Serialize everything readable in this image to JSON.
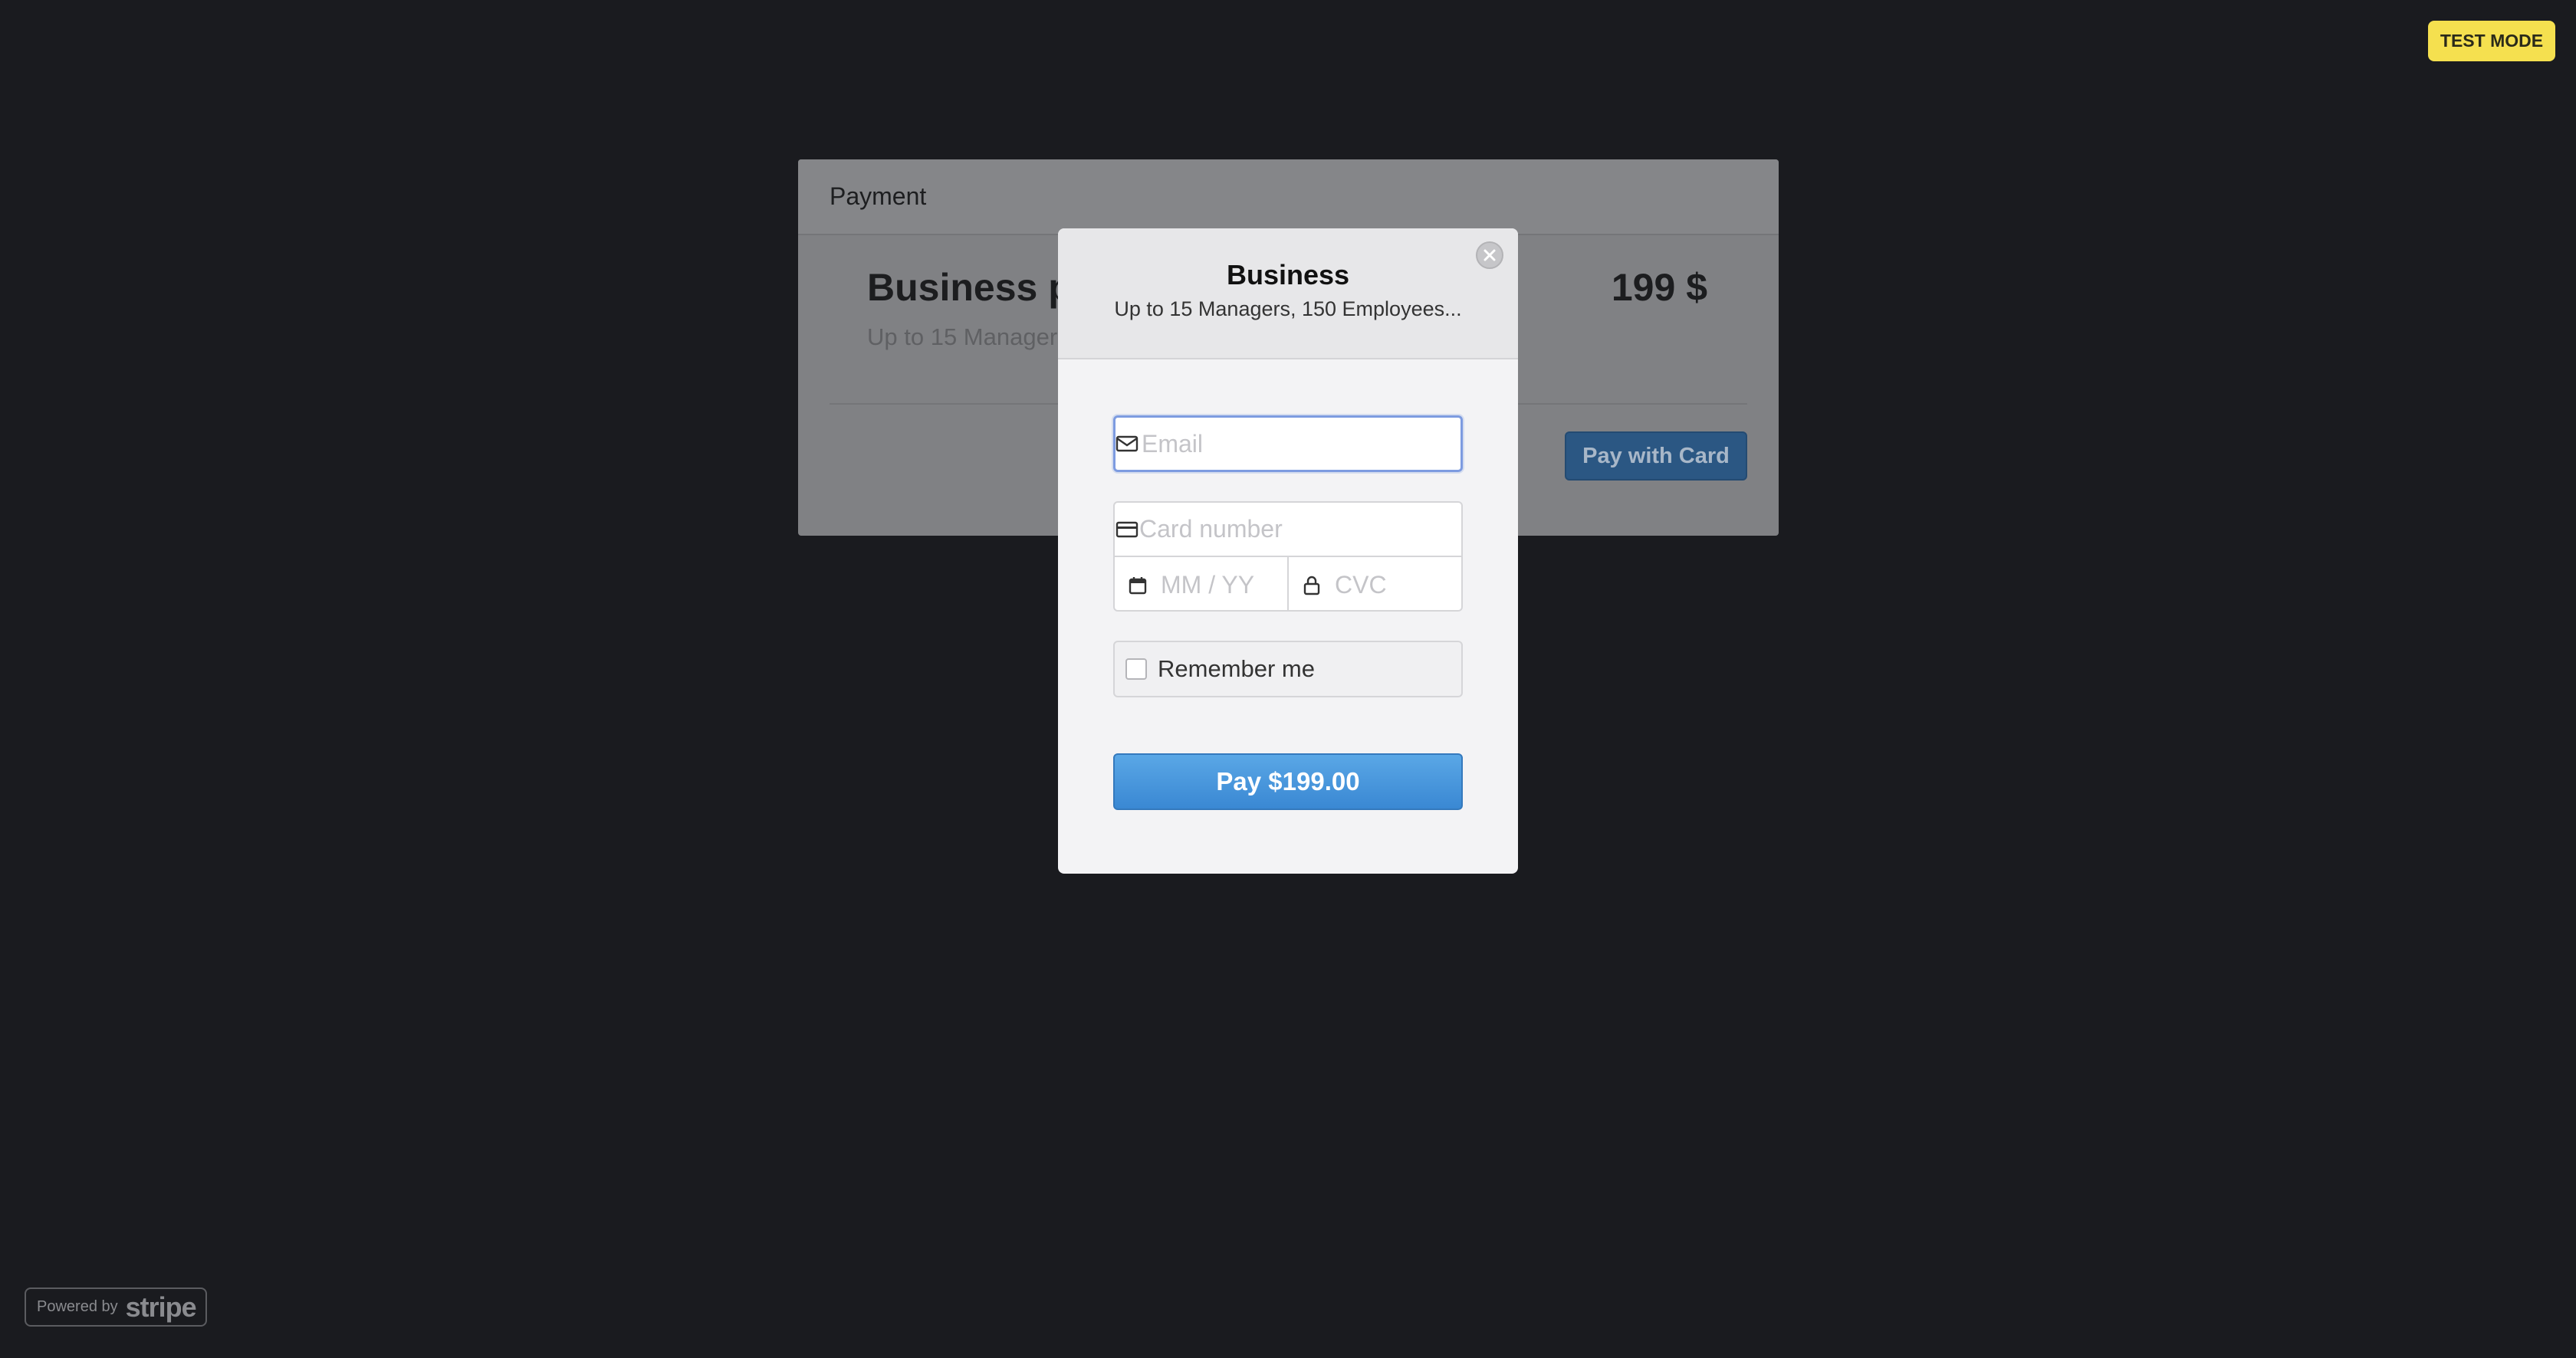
{
  "background": {
    "card_title": "Payment",
    "plan_name": "Business p",
    "plan_description": "Up to 15 Managers",
    "price": "199 $",
    "pay_button_label": "Pay with Card"
  },
  "badge": {
    "test_mode": "TEST MODE"
  },
  "footer": {
    "powered_by": "Powered by",
    "brand": "stripe"
  },
  "checkout": {
    "title": "Business",
    "subtitle": "Up to 15 Managers, 150 Employees...",
    "email_placeholder": "Email",
    "card_number_placeholder": "Card number",
    "expiry_placeholder": "MM / YY",
    "cvc_placeholder": "CVC",
    "remember_label": "Remember me",
    "pay_label": "Pay $199.00"
  },
  "colors": {
    "backdrop": "#1a1b1f",
    "accent": "#3a88d3",
    "badge": "#f5e04f"
  },
  "icons": {
    "close": "close-icon",
    "email": "envelope-icon",
    "card": "credit-card-icon",
    "expiry": "calendar-icon",
    "cvc": "lock-icon"
  }
}
